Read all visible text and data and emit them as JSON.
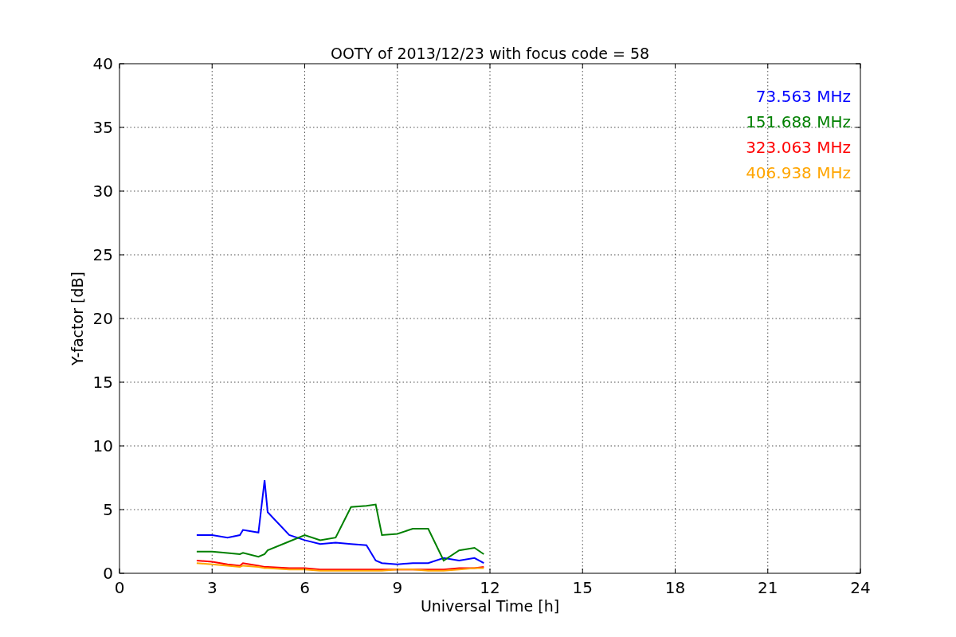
{
  "chart_data": {
    "type": "line",
    "title": "OOTY of 2013/12/23 with focus code = 58",
    "xlabel": "Universal Time [h]",
    "ylabel": "Y-factor [dB]",
    "x": [
      2.5,
      3,
      3.5,
      3.9,
      4,
      4.5,
      4.7,
      4.8,
      5.5,
      6,
      6.5,
      7,
      7.5,
      8,
      8.3,
      8.5,
      9,
      9.5,
      10,
      10.5,
      11,
      11.5,
      11.8
    ],
    "series": [
      {
        "name": "73.563 MHz",
        "color": "#0000ff",
        "values": [
          3.0,
          3.0,
          2.8,
          3.0,
          3.4,
          3.2,
          7.3,
          4.8,
          3.0,
          2.6,
          2.3,
          2.4,
          2.3,
          2.2,
          1.0,
          0.8,
          0.7,
          0.8,
          0.8,
          1.2,
          1.0,
          1.2,
          0.8
        ]
      },
      {
        "name": "151.688 MHz",
        "color": "#008000",
        "values": [
          1.7,
          1.7,
          1.6,
          1.5,
          1.6,
          1.3,
          1.5,
          1.8,
          2.5,
          3.0,
          2.6,
          2.8,
          5.2,
          5.3,
          5.4,
          3.0,
          3.1,
          3.5,
          3.5,
          1.0,
          1.8,
          2.0,
          1.5
        ]
      },
      {
        "name": "323.063 MHz",
        "color": "#ff0000",
        "values": [
          1.0,
          0.9,
          0.7,
          0.6,
          0.8,
          0.6,
          0.5,
          0.5,
          0.4,
          0.4,
          0.3,
          0.3,
          0.3,
          0.3,
          0.3,
          0.3,
          0.3,
          0.3,
          0.3,
          0.3,
          0.4,
          0.4,
          0.5
        ]
      },
      {
        "name": "406.938 MHz",
        "color": "#ffa500",
        "values": [
          0.8,
          0.7,
          0.6,
          0.5,
          0.6,
          0.5,
          0.4,
          0.4,
          0.3,
          0.3,
          0.2,
          0.2,
          0.2,
          0.2,
          0.2,
          0.2,
          0.3,
          0.3,
          0.2,
          0.2,
          0.3,
          0.4,
          0.4
        ]
      }
    ],
    "xlim": [
      0,
      24
    ],
    "ylim": [
      0,
      40
    ],
    "xticks": [
      0,
      3,
      6,
      9,
      12,
      15,
      18,
      21,
      24
    ],
    "yticks": [
      0,
      5,
      10,
      15,
      20,
      25,
      30,
      35,
      40
    ],
    "grid": true
  }
}
